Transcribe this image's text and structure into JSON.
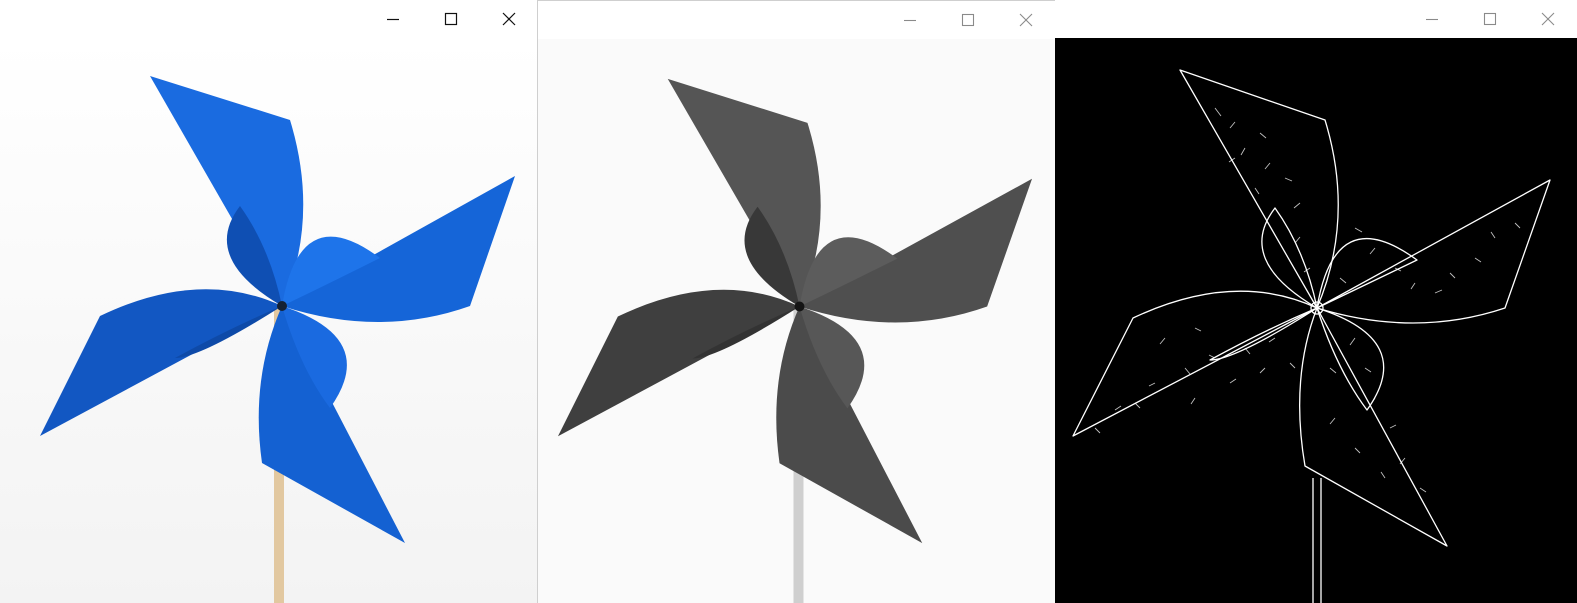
{
  "colors": {
    "pinwheel_blue": "#1565d8",
    "pinwheel_gray": "#4a4a4a",
    "stick_wood": "#e2c8a0",
    "stick_gray": "#cfcfcf",
    "edge_background": "#000000",
    "edge_lines": "#ffffff",
    "titlebar": "#ffffff"
  },
  "windows": [
    {
      "id": "original",
      "content": "color-image",
      "controls": [
        "minimize-icon",
        "maximize-icon",
        "close-icon"
      ],
      "active": true
    },
    {
      "id": "grayscale",
      "content": "grayscale-image",
      "controls": [
        "minimize-icon",
        "maximize-icon",
        "close-icon"
      ],
      "active": false
    },
    {
      "id": "edges",
      "content": "edge-detection-image",
      "controls": [
        "minimize-icon",
        "maximize-icon",
        "close-icon"
      ],
      "active": false
    }
  ]
}
